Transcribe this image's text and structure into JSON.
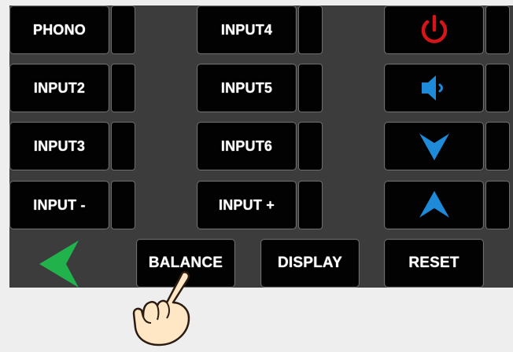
{
  "buttons": {
    "phono": "PHONO",
    "input2": "INPUT2",
    "input3": "INPUT3",
    "input_minus": "INPUT -",
    "input4": "INPUT4",
    "input5": "INPUT5",
    "input6": "INPUT6",
    "input_plus": "INPUT +",
    "balance": "BALANCE",
    "display": "DISPLAY",
    "reset": "RESET"
  },
  "icons": {
    "power": "power-icon",
    "speaker": "speaker-icon",
    "volume_down": "chevron-down-icon",
    "volume_up": "chevron-up-icon",
    "back": "back-arrow-icon",
    "hand": "pointing-hand-icon"
  },
  "colors": {
    "panel_bg": "#3c3c3c",
    "button_bg": "#020202",
    "button_border": "#6e6e6e",
    "power": "#d4161b",
    "accent_blue": "#1f8ad8",
    "back_arrow": "#22b24c",
    "page_bg": "#eeeeee"
  }
}
